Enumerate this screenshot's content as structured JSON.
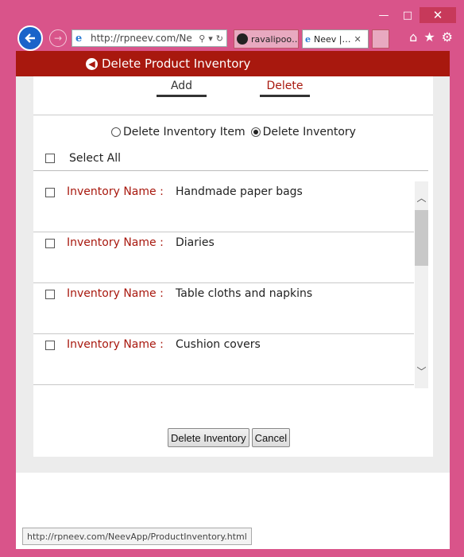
{
  "window": {
    "minimize": "—",
    "maximize": "□",
    "close": "✕"
  },
  "browser": {
    "url": "http://rpneev.com/Ne",
    "tabs": [
      {
        "label": "ravalipoo…"
      },
      {
        "label": "Neev |…"
      }
    ],
    "status_url": "http://rpneev.com/NeevApp/ProductInventory.html"
  },
  "header": {
    "title": "Delete Product Inventory"
  },
  "mode_tabs": {
    "add": "Add",
    "delete": "Delete"
  },
  "radio_options": {
    "item": "Delete Inventory Item",
    "inventory": "Delete Inventory",
    "selected": "inventory"
  },
  "select_all_label": "Select All",
  "inventory_label": "Inventory Name :",
  "inventories": [
    {
      "name": "Handmade paper bags"
    },
    {
      "name": "Diaries"
    },
    {
      "name": "Table cloths and napkins"
    },
    {
      "name": "Cushion covers"
    }
  ],
  "buttons": {
    "delete": "Delete Inventory",
    "cancel": "Cancel"
  },
  "colors": {
    "accent": "#a8180e",
    "frame": "#d9548a"
  }
}
